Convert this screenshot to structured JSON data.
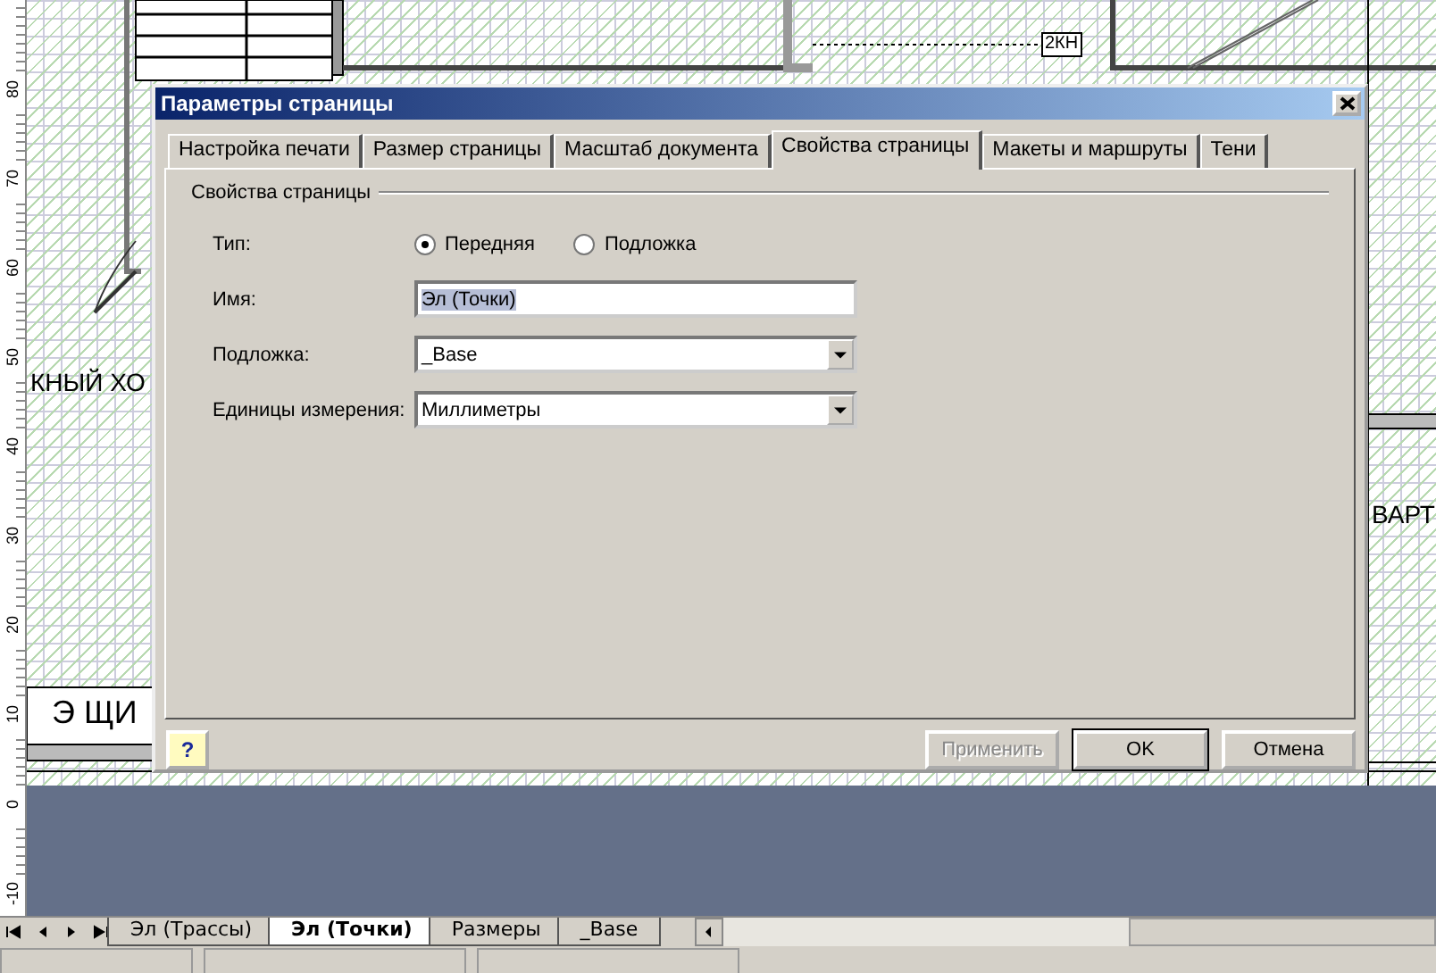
{
  "ruler": {
    "marks": [
      "80",
      "70",
      "60",
      "50",
      "40",
      "30",
      "20",
      "10",
      "0",
      "-10"
    ]
  },
  "canvas": {
    "labels": [
      {
        "text": "2КН",
        "kind": "tag"
      },
      {
        "text": "КНЫЙ ХО",
        "kind": "room"
      },
      {
        "text": "Э ЩИ",
        "kind": "room"
      },
      {
        "text": "ВАРТ",
        "kind": "room"
      }
    ]
  },
  "dialog": {
    "title": "Параметры страницы",
    "tabs": [
      {
        "label": "Настройка печати",
        "selected": false
      },
      {
        "label": "Размер страницы",
        "selected": false
      },
      {
        "label": "Масштаб документа",
        "selected": false
      },
      {
        "label": "Свойства страницы",
        "selected": true
      },
      {
        "label": "Макеты и маршруты",
        "selected": false
      },
      {
        "label": "Тени",
        "selected": false
      }
    ],
    "group": "Свойства страницы",
    "fields": [
      {
        "kind": "radio",
        "label": "Тип:",
        "options": [
          {
            "label": "Передняя",
            "selected": true
          },
          {
            "label": "Подложка",
            "selected": false
          }
        ]
      },
      {
        "kind": "text",
        "label": "Имя:",
        "value": "Эл (Точки)",
        "text_selected": true
      },
      {
        "kind": "dropdown",
        "label": "Подложка:",
        "value": "_Base"
      },
      {
        "kind": "dropdown",
        "label": "Единицы измерения:",
        "value": "Миллиметры"
      }
    ],
    "help": "?",
    "buttons": [
      {
        "label": "Применить",
        "disabled": true,
        "default": false
      },
      {
        "label": "OK",
        "disabled": false,
        "default": true
      },
      {
        "label": "Отмена",
        "disabled": false,
        "default": false
      }
    ]
  },
  "sheet_tabs": [
    {
      "label": "Эл (Трассы)",
      "selected": false
    },
    {
      "label": "Эл (Точки)",
      "selected": true
    },
    {
      "label": "Размеры",
      "selected": false
    },
    {
      "label": "_Base",
      "selected": false
    }
  ]
}
